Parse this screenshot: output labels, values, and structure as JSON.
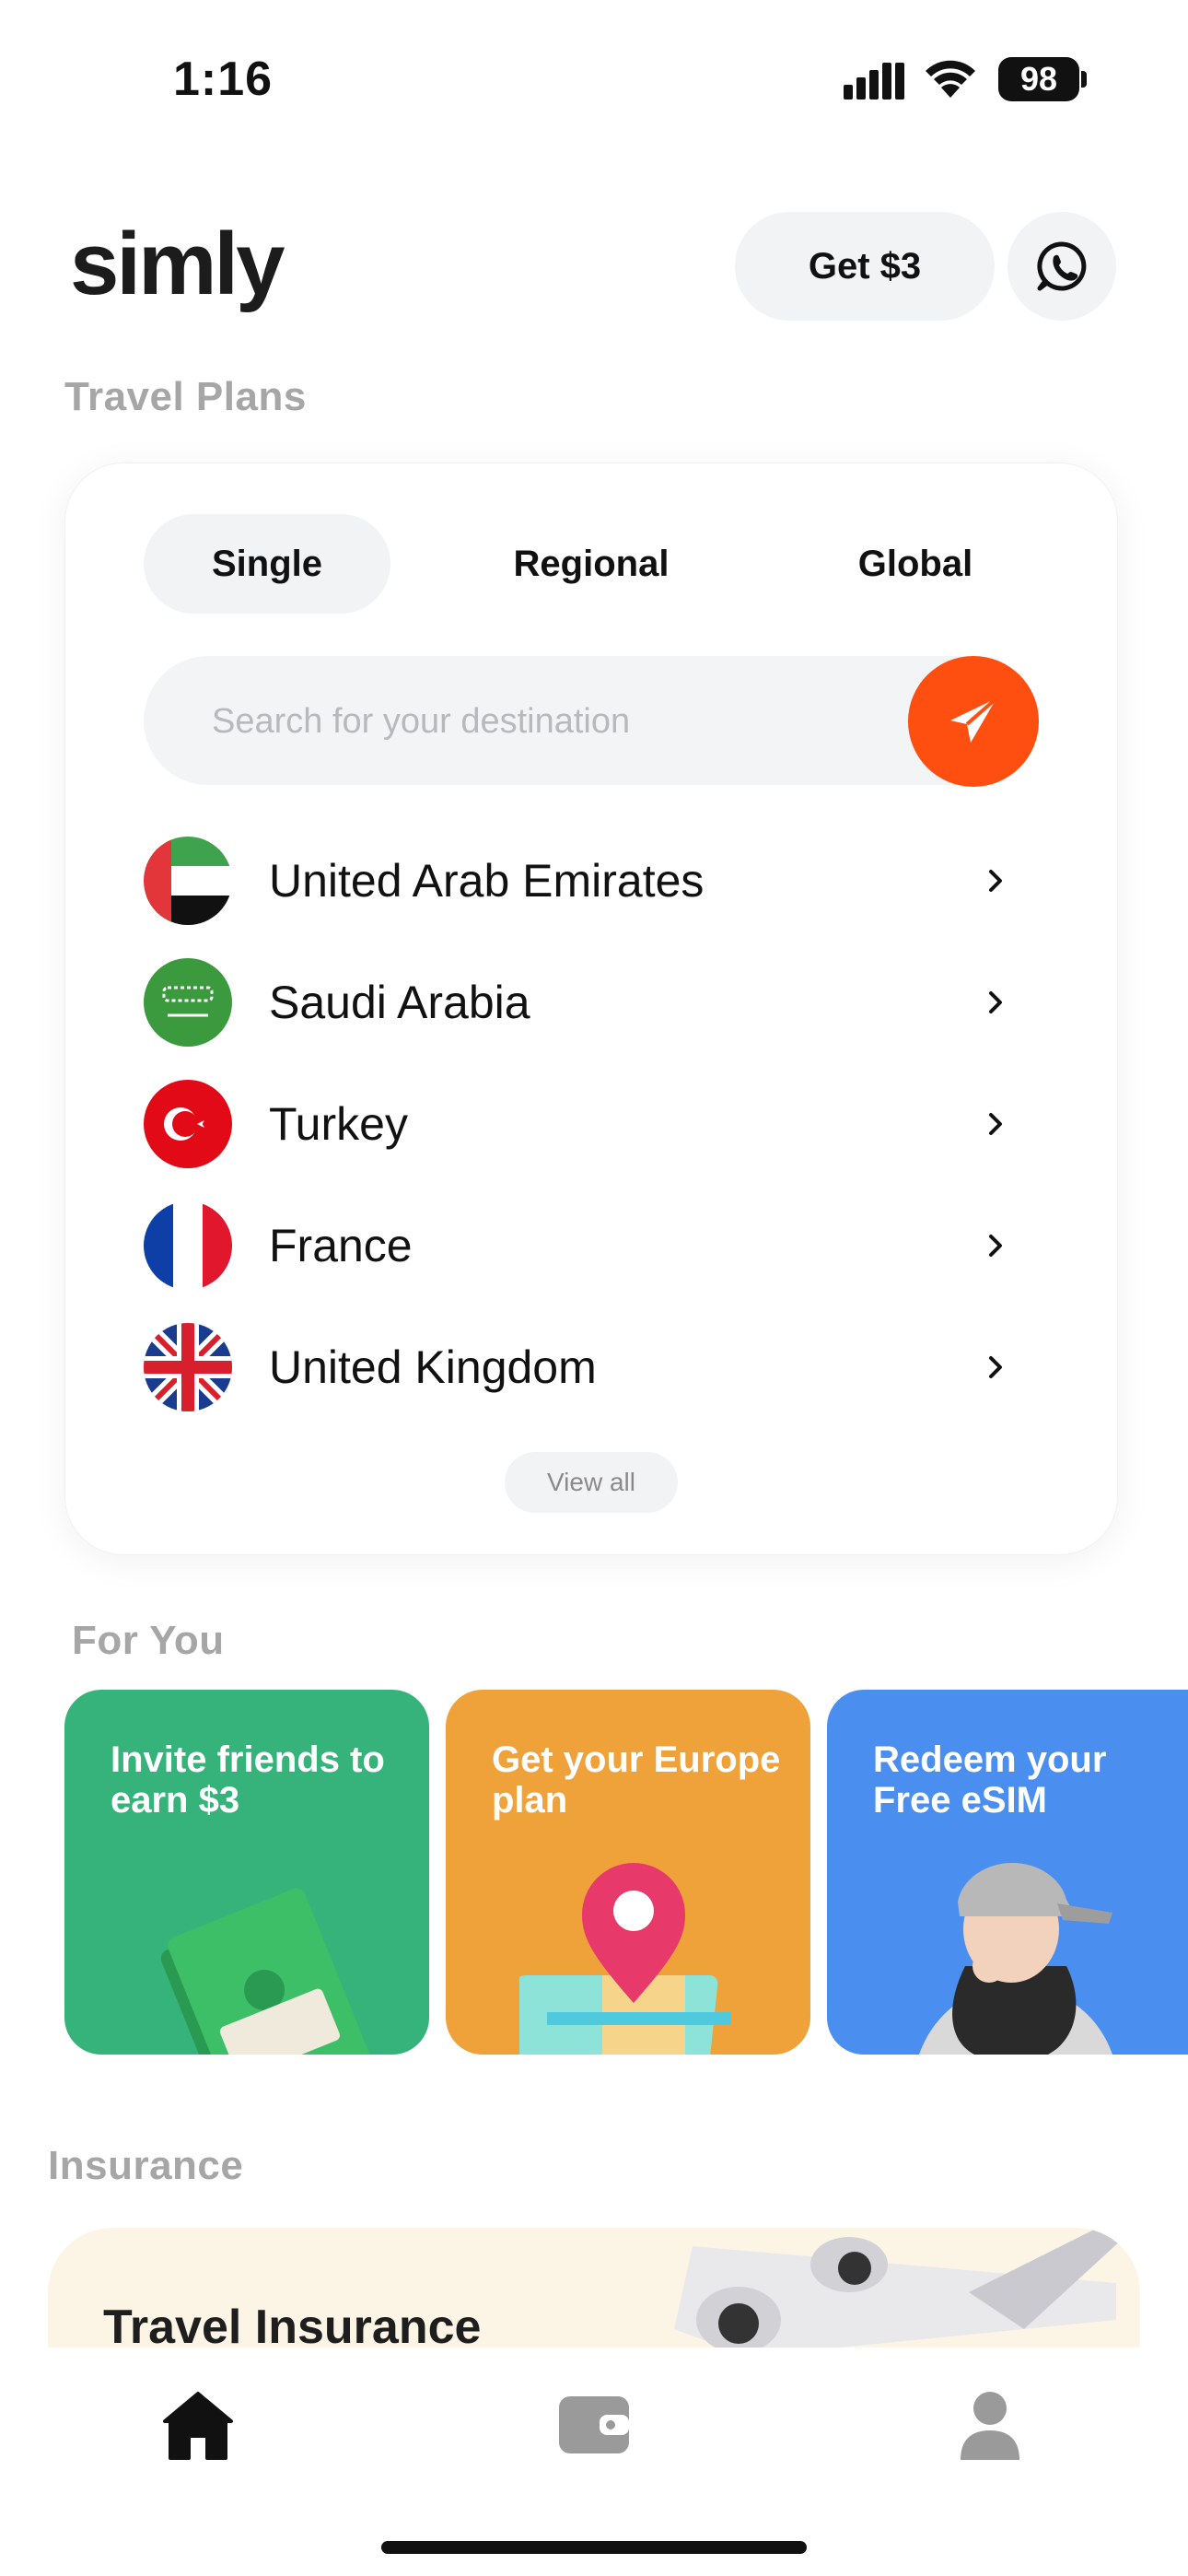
{
  "status_bar": {
    "time": "1:16",
    "battery": "98"
  },
  "header": {
    "logo": "simly",
    "get_button": "Get $3"
  },
  "travel_plans": {
    "title": "Travel Plans",
    "tabs": [
      "Single",
      "Regional",
      "Global"
    ],
    "active_tab": "Single",
    "search_placeholder": "Search for your destination",
    "countries": [
      "United Arab Emirates",
      "Saudi Arabia",
      "Turkey",
      "France",
      "United Kingdom"
    ],
    "view_all": "View all"
  },
  "for_you": {
    "title": "For You",
    "cards": [
      {
        "text": "Invite friends to earn $3",
        "color": "#36b37a"
      },
      {
        "text": "Get your Europe plan",
        "color": "#f0a23a"
      },
      {
        "text": "Redeem your Free eSIM",
        "color": "#4a8ff0"
      }
    ]
  },
  "insurance": {
    "title": "Insurance",
    "card_title": "Travel Insurance"
  },
  "colors": {
    "accent": "#fe4f10"
  },
  "nav": [
    "home-icon",
    "wallet-icon",
    "profile-icon"
  ]
}
